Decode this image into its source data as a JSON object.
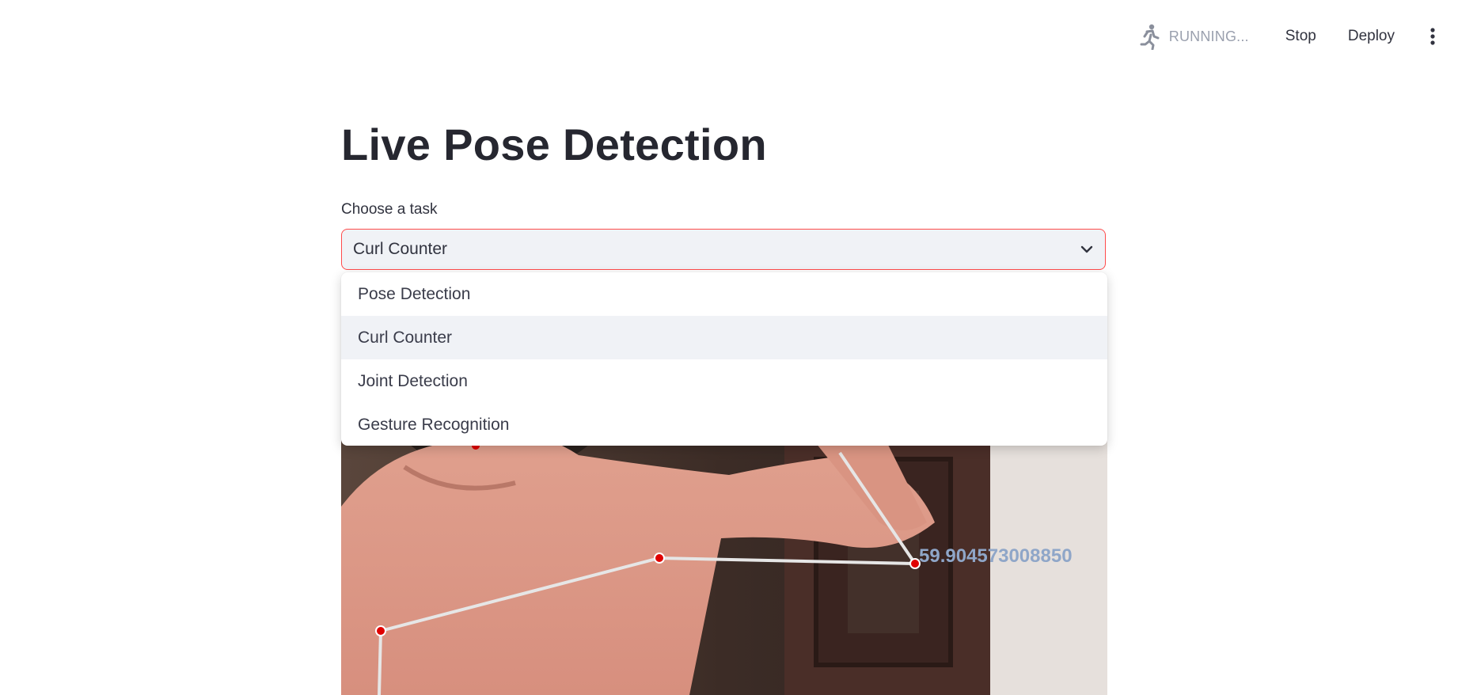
{
  "toolbar": {
    "status_label": "RUNNING...",
    "stop_label": "Stop",
    "deploy_label": "Deploy"
  },
  "main": {
    "title": "Live Pose Detection",
    "select_label": "Choose a task",
    "selected_value": "Curl Counter",
    "options": [
      {
        "label": "Pose Detection",
        "active": false
      },
      {
        "label": "Curl Counter",
        "active": true
      },
      {
        "label": "Joint Detection",
        "active": false
      },
      {
        "label": "Gesture Recognition",
        "active": false
      }
    ]
  },
  "video": {
    "angle_text": "59.904573008850"
  },
  "colors": {
    "accent": "#ff4b4b",
    "select_bg": "#f0f2f6",
    "landmark": "#e00000",
    "angle_text": "#8fa6c8"
  }
}
